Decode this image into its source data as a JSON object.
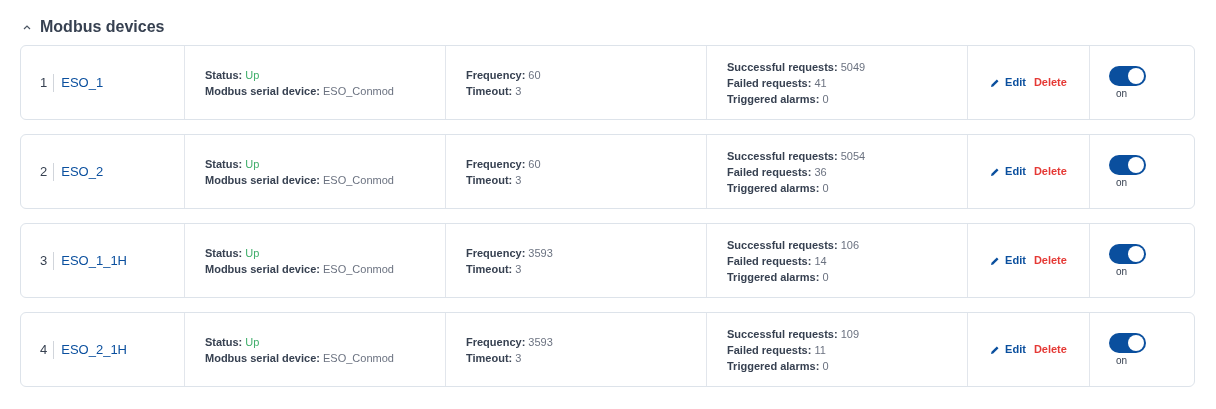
{
  "section": {
    "title": "Modbus devices",
    "expanded": true
  },
  "devices": [
    {
      "index": "1",
      "name": "ESO_1",
      "status": [
        {
          "label": "Status:",
          "value": "Up",
          "kind": "status"
        },
        {
          "label": "Modbus serial device:",
          "value": "ESO_Conmod",
          "kind": "plain"
        }
      ],
      "timing": [
        {
          "label": "Frequency:",
          "value": "60"
        },
        {
          "label": "Timeout:",
          "value": "3"
        }
      ],
      "stats": [
        {
          "label": "Successful requests:",
          "value": "5049"
        },
        {
          "label": "Failed requests:",
          "value": "41"
        },
        {
          "label": "Triggered alarms:",
          "value": "0"
        }
      ],
      "edit": "Edit",
      "delete": "Delete",
      "on": true,
      "toggle_label": "on"
    },
    {
      "index": "2",
      "name": "ESO_2",
      "status": [
        {
          "label": "Status:",
          "value": "Up",
          "kind": "status"
        },
        {
          "label": "Modbus serial device:",
          "value": "ESO_Conmod",
          "kind": "plain"
        }
      ],
      "timing": [
        {
          "label": "Frequency:",
          "value": "60"
        },
        {
          "label": "Timeout:",
          "value": "3"
        }
      ],
      "stats": [
        {
          "label": "Successful requests:",
          "value": "5054"
        },
        {
          "label": "Failed requests:",
          "value": "36"
        },
        {
          "label": "Triggered alarms:",
          "value": "0"
        }
      ],
      "edit": "Edit",
      "delete": "Delete",
      "on": true,
      "toggle_label": "on"
    },
    {
      "index": "3",
      "name": "ESO_1_1H",
      "status": [
        {
          "label": "Status:",
          "value": "Up",
          "kind": "status"
        },
        {
          "label": "Modbus serial device:",
          "value": "ESO_Conmod",
          "kind": "plain"
        }
      ],
      "timing": [
        {
          "label": "Frequency:",
          "value": "3593"
        },
        {
          "label": "Timeout:",
          "value": "3"
        }
      ],
      "stats": [
        {
          "label": "Successful requests:",
          "value": "106"
        },
        {
          "label": "Failed requests:",
          "value": "14"
        },
        {
          "label": "Triggered alarms:",
          "value": "0"
        }
      ],
      "edit": "Edit",
      "delete": "Delete",
      "on": true,
      "toggle_label": "on"
    },
    {
      "index": "4",
      "name": "ESO_2_1H",
      "status": [
        {
          "label": "Status:",
          "value": "Up",
          "kind": "status"
        },
        {
          "label": "Modbus serial device:",
          "value": "ESO_Conmod",
          "kind": "plain"
        }
      ],
      "timing": [
        {
          "label": "Frequency:",
          "value": "3593"
        },
        {
          "label": "Timeout:",
          "value": "3"
        }
      ],
      "stats": [
        {
          "label": "Successful requests:",
          "value": "109"
        },
        {
          "label": "Failed requests:",
          "value": "11"
        },
        {
          "label": "Triggered alarms:",
          "value": "0"
        }
      ],
      "edit": "Edit",
      "delete": "Delete",
      "on": true,
      "toggle_label": "on"
    }
  ]
}
